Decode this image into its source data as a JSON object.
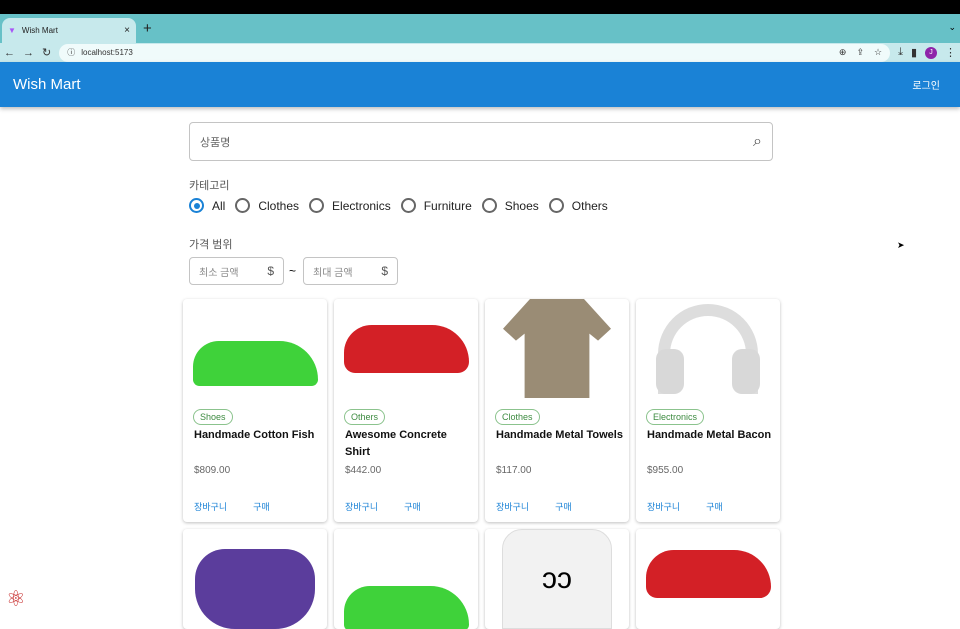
{
  "browser": {
    "tab_title": "Wish Mart",
    "url": "localhost:5173",
    "avatar_initial": "J"
  },
  "app": {
    "title": "Wish Mart",
    "login": "로그인"
  },
  "search": {
    "placeholder": "상품명"
  },
  "filters": {
    "category_label": "카테고리",
    "categories": [
      "All",
      "Clothes",
      "Electronics",
      "Furniture",
      "Shoes",
      "Others"
    ],
    "selected": "All",
    "price_label": "가격 범위",
    "min_placeholder": "최소 금액",
    "max_placeholder": "최대 금액",
    "currency": "$",
    "separator": "~"
  },
  "products": [
    {
      "category": "Shoes",
      "name": "Handmade Cotton Fish",
      "price": "$809.00",
      "image": "green-sneaker"
    },
    {
      "category": "Others",
      "name": "Awesome Concrete Shirt",
      "price": "$442.00",
      "image": "red-car"
    },
    {
      "category": "Clothes",
      "name": "Handmade Metal Towels",
      "price": "$117.00",
      "image": "tan-tshirt"
    },
    {
      "category": "Electronics",
      "name": "Handmade Metal Bacon",
      "price": "$955.00",
      "image": "headphones"
    }
  ],
  "second_row_images": [
    "game-controller",
    "green-sneaker",
    "chanel-sweatshirt",
    "red-car"
  ],
  "card_actions": {
    "cart": "장바구니",
    "buy": "구매"
  }
}
